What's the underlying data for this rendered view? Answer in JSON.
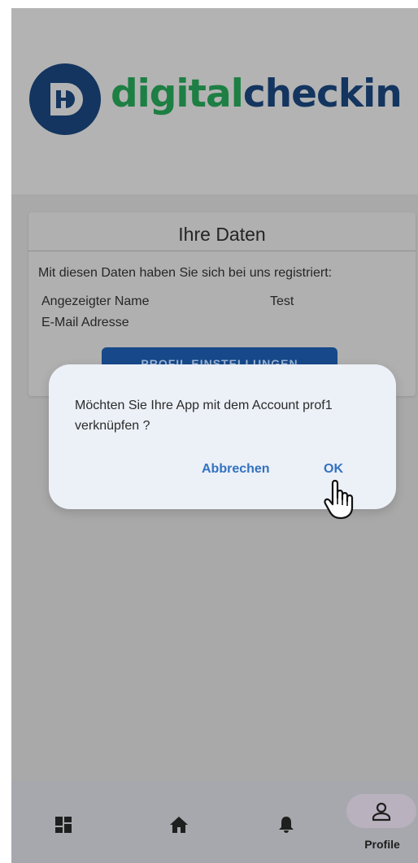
{
  "brand": {
    "name_part1": "digital",
    "name_part2": "checkin",
    "colors": {
      "digital": "#1d7f43",
      "checkin": "#13355f",
      "mark": "#13355f"
    }
  },
  "card": {
    "title": "Ihre Daten",
    "intro": "Mit diesen Daten haben Sie sich bei uns registriert:",
    "fields": [
      {
        "label": "Angezeigter Name",
        "value": "Test"
      },
      {
        "label": "E-Mail Adresse",
        "value": ""
      }
    ],
    "button_label": "PROFIL EINSTELLUNGEN"
  },
  "dialog": {
    "message": "Möchten Sie Ihre App mit dem Account prof1 verknüpfen ?",
    "cancel_label": "Abbrechen",
    "ok_label": "OK",
    "accent_color": "#3272c2"
  },
  "bottom_nav": {
    "items": [
      {
        "icon": "dashboard-icon"
      },
      {
        "icon": "home-icon"
      },
      {
        "icon": "bell-icon"
      },
      {
        "icon": "person-icon",
        "label": "Profile",
        "active": true
      }
    ]
  }
}
